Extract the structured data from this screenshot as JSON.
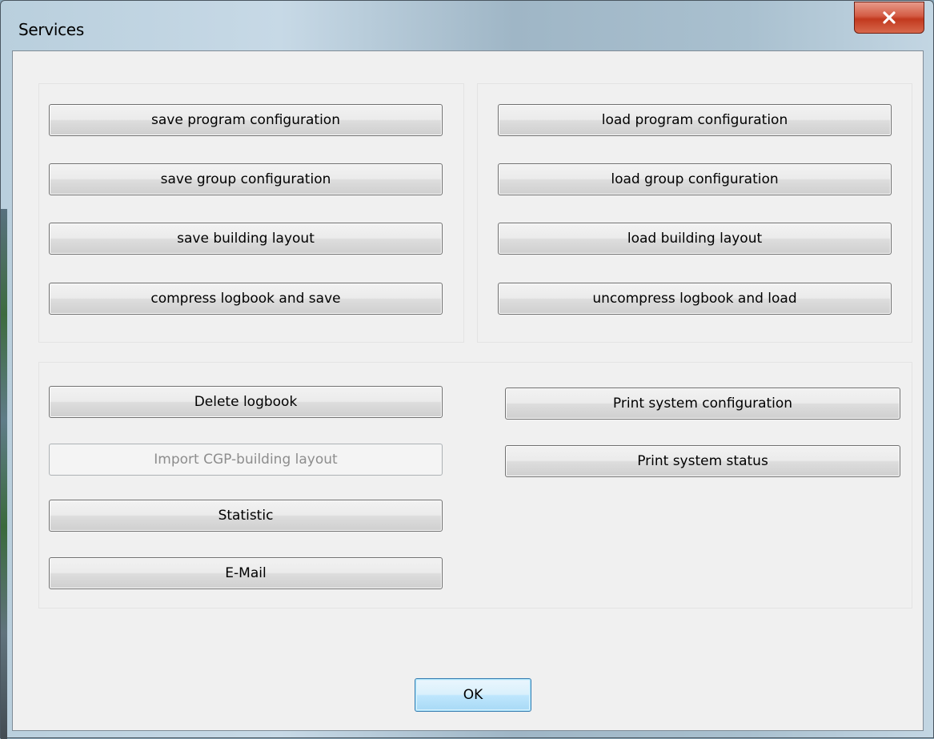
{
  "window": {
    "title": "Services",
    "close_icon": "close-x-icon",
    "accent_color": "#c2391e"
  },
  "left_panel": {
    "buttons": [
      {
        "label": "save program configuration"
      },
      {
        "label": "save group configuration"
      },
      {
        "label": "save building layout"
      },
      {
        "label": "compress logbook and save"
      }
    ]
  },
  "right_panel": {
    "buttons": [
      {
        "label": "load program configuration"
      },
      {
        "label": "load group configuration"
      },
      {
        "label": "load building layout"
      },
      {
        "label": "uncompress logbook and load"
      }
    ]
  },
  "bottom_panel": {
    "left_buttons": [
      {
        "label": "Delete logbook",
        "enabled": true
      },
      {
        "label": "Import CGP-building layout",
        "enabled": false
      },
      {
        "label": "Statistic",
        "enabled": true
      },
      {
        "label": "E-Mail",
        "enabled": true
      }
    ],
    "right_buttons": [
      {
        "label": "Print system configuration",
        "enabled": true
      },
      {
        "label": "Print system status",
        "enabled": true
      }
    ]
  },
  "footer": {
    "ok_label": "OK"
  }
}
